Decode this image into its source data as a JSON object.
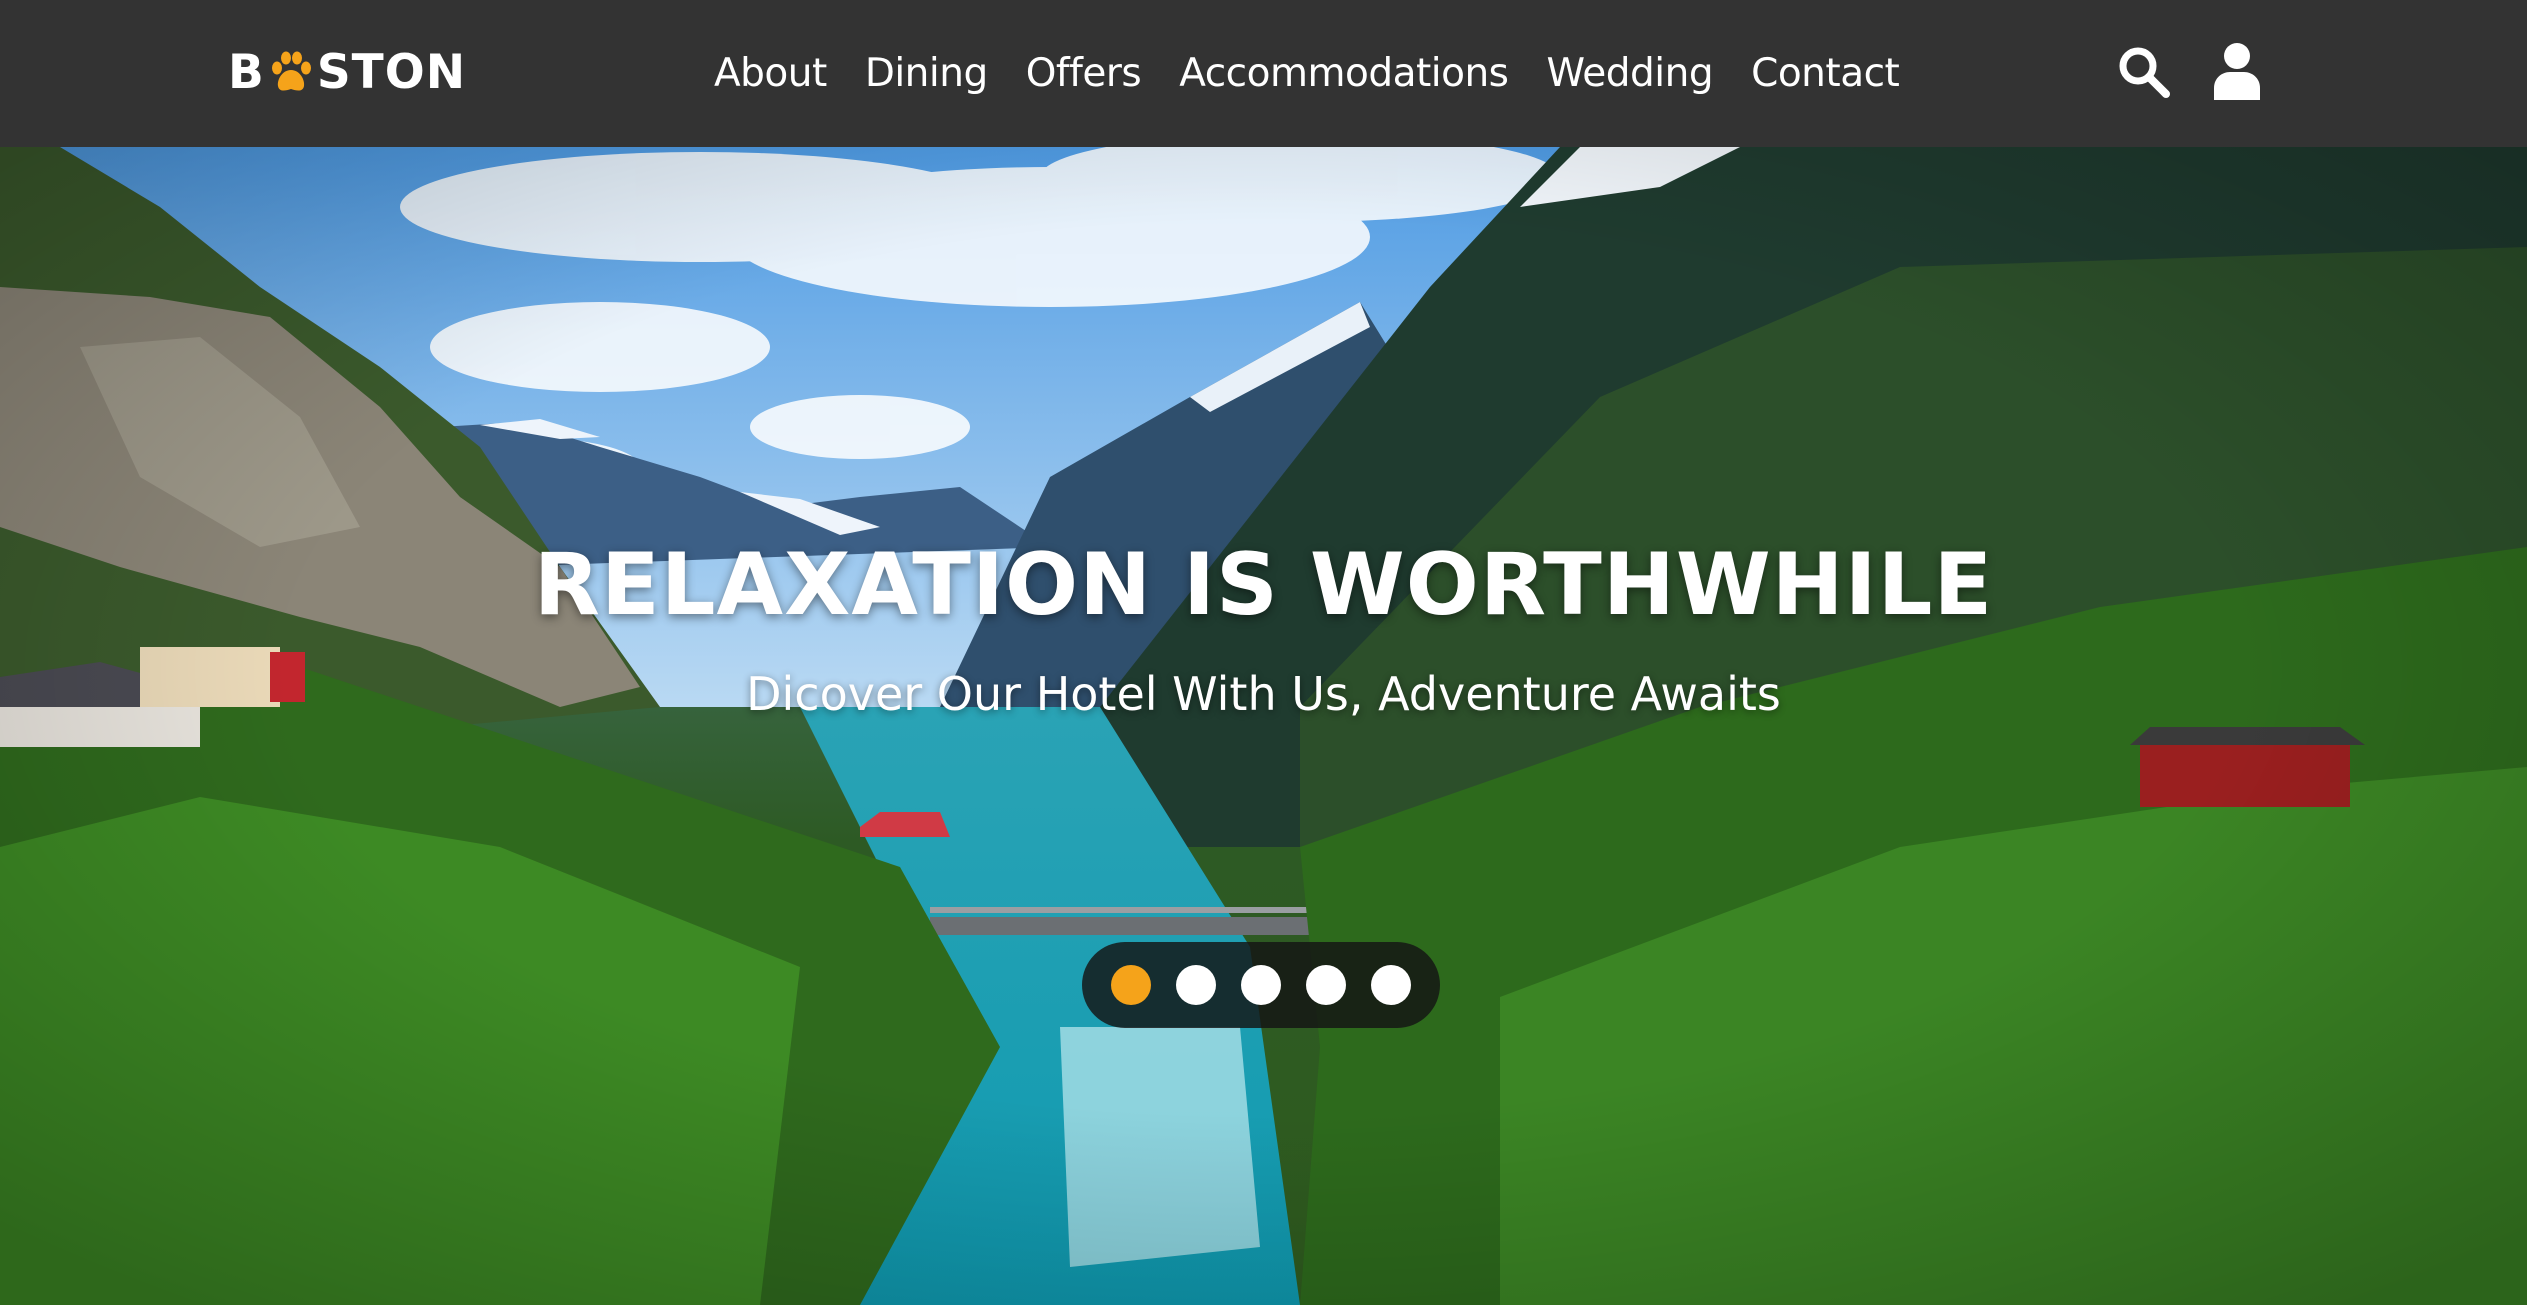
{
  "brand": {
    "logo_prefix": "B",
    "logo_suffix": "STON",
    "paw_icon": "paw-icon",
    "paw_color": "#f5a31a"
  },
  "nav": {
    "items": [
      {
        "label": "About"
      },
      {
        "label": "Dining"
      },
      {
        "label": "Offers"
      },
      {
        "label": "Accommodations"
      },
      {
        "label": "Wedding"
      },
      {
        "label": "Contact"
      }
    ]
  },
  "header_icons": {
    "search": "search-icon",
    "user": "user-icon"
  },
  "hero": {
    "title": "RELAXATION IS WORTHWHILE",
    "subtitle": "Dicover Our Hotel With Us, Adventure Awaits",
    "background": "mountain-valley-river-image"
  },
  "carousel": {
    "slide_count": 5,
    "active_index": 0,
    "active_color": "#f5a31a",
    "inactive_color": "#ffffff"
  },
  "colors": {
    "header_bg": "#333333",
    "text": "#ffffff",
    "accent": "#f5a31a"
  }
}
